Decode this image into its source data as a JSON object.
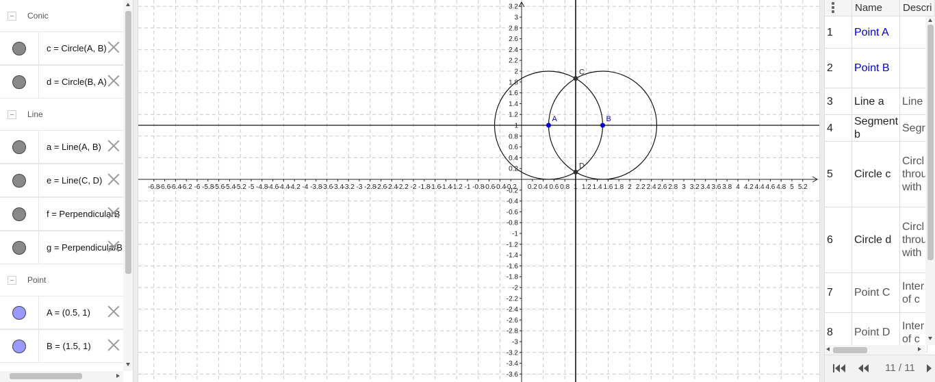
{
  "algebra": {
    "groups": [
      {
        "label": "Conic",
        "items": [
          {
            "text": "c = Circle(A, B)",
            "marble_color": "#888888"
          },
          {
            "text": "d = Circle(B, A)",
            "marble_color": "#888888"
          }
        ]
      },
      {
        "label": "Line",
        "items": [
          {
            "text": "a = Line(A, B)",
            "marble_color": "#888888"
          },
          {
            "text": "e = Line(C, D)",
            "marble_color": "#888888"
          },
          {
            "text": "f = PerpendicularB",
            "marble_color": "#888888"
          },
          {
            "text": "g = PerpendicularB",
            "marble_color": "#888888"
          }
        ]
      },
      {
        "label": "Point",
        "items": [
          {
            "text": "A = (0.5, 1)",
            "marble_color": "#9999ff"
          },
          {
            "text": "B = (1.5, 1)",
            "marble_color": "#9999ff"
          }
        ]
      }
    ]
  },
  "graphics": {
    "x_ticks": [
      "-6.8",
      "-6.6",
      "-6.4",
      "-6.2",
      "-6",
      "-5.8",
      "-5.6",
      "-5.4",
      "-5.2",
      "-5",
      "-4.8",
      "-4.6",
      "-4.4",
      "-4.2",
      "-4",
      "-3.8",
      "-3.6",
      "-3.4",
      "-3.2",
      "-3",
      "-2.8",
      "-2.6",
      "-2.4",
      "-2.2",
      "-2",
      "-1.8",
      "-1.6",
      "-1.4",
      "-1.2",
      "-1",
      "-0.8",
      "-0.6",
      "-0.4",
      "-0.2",
      "0.2",
      "0.4",
      "0.6",
      "0.8",
      "1",
      "1.2",
      "1.4",
      "1.6",
      "1.8",
      "2",
      "2.2",
      "2.4",
      "2.6",
      "2.8",
      "3",
      "3.2",
      "3.4",
      "3.6",
      "3.8",
      "4",
      "4.2",
      "4.4",
      "4.6",
      "4.8",
      "5",
      "5.2"
    ],
    "y_ticks": [
      "3.2",
      "3",
      "2.8",
      "2.6",
      "2.4",
      "2.2",
      "2",
      "1.8",
      "1.6",
      "1.4",
      "1.2",
      "1",
      "0.8",
      "0.6",
      "0.4",
      "0.2",
      "-0.2",
      "-0.4",
      "-0.6",
      "-0.8",
      "-1",
      "-1.2",
      "-1.4",
      "-1.6",
      "-1.8",
      "-2",
      "-2.2",
      "-2.4",
      "-2.6",
      "-2.8",
      "-3",
      "-3.2",
      "-3.4",
      "-3.6"
    ],
    "points": [
      {
        "label": "A",
        "x": 0.5,
        "y": 1,
        "color": "#0000cc"
      },
      {
        "label": "B",
        "x": 1.5,
        "y": 1,
        "color": "#0000cc"
      },
      {
        "label": "C",
        "x": 1,
        "y": 1.866,
        "color": "#333333"
      },
      {
        "label": "D",
        "x": 1,
        "y": 0.134,
        "color": "#333333"
      }
    ],
    "circles": [
      {
        "name": "c",
        "cx": 0.5,
        "cy": 1,
        "r": 1
      },
      {
        "name": "d",
        "cx": 1.5,
        "cy": 1,
        "r": 1
      }
    ],
    "lines": [
      {
        "name": "a",
        "type": "horizontal",
        "y": 1
      },
      {
        "name": "e",
        "type": "vertical",
        "x": 1
      }
    ]
  },
  "protocol": {
    "columns": [
      "Name",
      "Descri"
    ],
    "rows": [
      {
        "num": "1",
        "name": "Point A",
        "desc": "",
        "color": "#0000cc"
      },
      {
        "num": "2",
        "name": "Point B",
        "desc": "",
        "color": "#0000cc"
      },
      {
        "num": "3",
        "name": "Line a",
        "desc": "Line",
        "color": "#222222"
      },
      {
        "num": "4",
        "name": "Segment b",
        "desc": "Segr",
        "color": "#222222"
      },
      {
        "num": "5",
        "name": "Circle c",
        "desc": "Circl\nthrou\nwith",
        "color": "#222222"
      },
      {
        "num": "6",
        "name": "Circle d",
        "desc": "Circl\nthrou\nwith",
        "color": "#222222"
      },
      {
        "num": "7",
        "name": "Point C",
        "desc": "Inter\nof c",
        "color": "#555555"
      },
      {
        "num": "8",
        "name": "Point D",
        "desc": "Inter\nof c",
        "color": "#555555"
      }
    ],
    "navigation": "11 / 11"
  }
}
